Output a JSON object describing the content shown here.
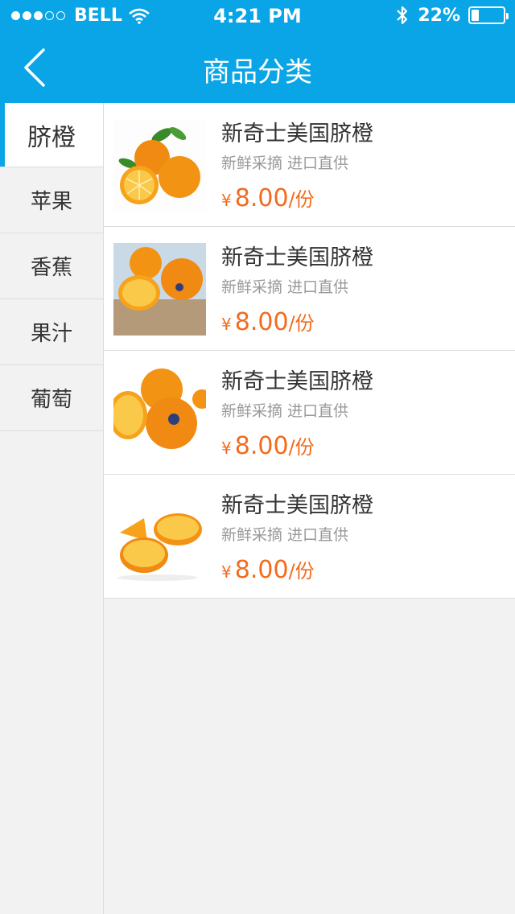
{
  "status_bar": {
    "carrier": "BELL",
    "time": "4:21 PM",
    "battery_percent_text": "22%",
    "battery_level": 0.22,
    "signal_bars": 3
  },
  "header": {
    "title": "商品分类"
  },
  "sidebar": {
    "items": [
      {
        "label": "脐橙",
        "active": true
      },
      {
        "label": "苹果",
        "active": false
      },
      {
        "label": "香蕉",
        "active": false
      },
      {
        "label": "果汁",
        "active": false
      },
      {
        "label": "葡萄",
        "active": false
      }
    ]
  },
  "products": [
    {
      "name": "新奇士美国脐橙",
      "subtitle": "新鲜采摘 进口直供",
      "currency": "¥",
      "price": "8.00",
      "unit": "/份"
    },
    {
      "name": "新奇士美国脐橙",
      "subtitle": "新鲜采摘 进口直供",
      "currency": "¥",
      "price": "8.00",
      "unit": "/份"
    },
    {
      "name": "新奇士美国脐橙",
      "subtitle": "新鲜采摘 进口直供",
      "currency": "¥",
      "price": "8.00",
      "unit": "/份"
    },
    {
      "name": "新奇士美国脐橙",
      "subtitle": "新鲜采摘 进口直供",
      "currency": "¥",
      "price": "8.00",
      "unit": "/份"
    }
  ],
  "colors": {
    "primary": "#0aa5e6",
    "price": "#f26b1d"
  }
}
